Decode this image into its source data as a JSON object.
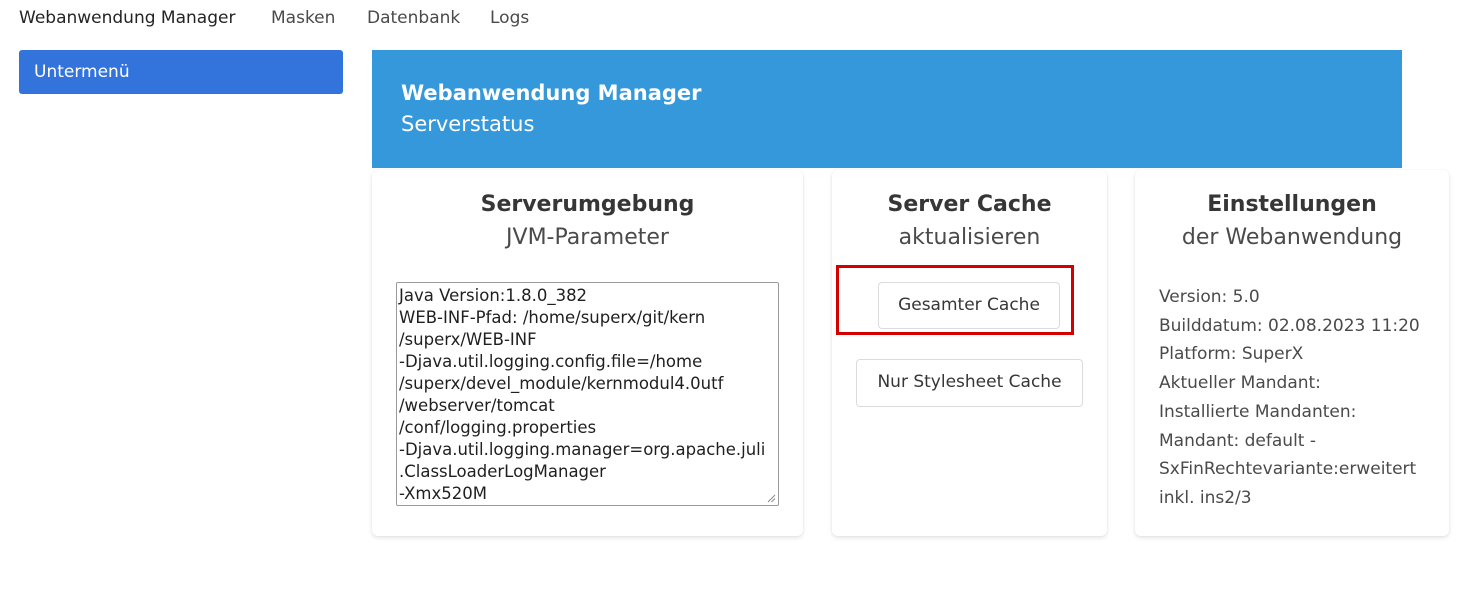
{
  "nav": {
    "brand": "Webanwendung Manager",
    "items": [
      "Masken",
      "Datenbank",
      "Logs"
    ]
  },
  "sidebar": {
    "submenu_label": "Untermenü"
  },
  "hero": {
    "title": "Webanwendung Manager",
    "subtitle": "Serverstatus",
    "color": "#3498db"
  },
  "cards": {
    "env": {
      "title": "Serverumgebung",
      "subtitle": "JVM-Parameter",
      "jvm_lines": [
        "Java Version:1.8.0_382",
        "WEB-INF-Pfad: /home/superx/git/kern",
        "/superx/WEB-INF",
        "-Djava.util.logging.config.file=/home",
        "/superx/devel_module/kernmodul4.0utf",
        "/webserver/tomcat",
        "/conf/logging.properties",
        "-Djava.util.logging.manager=org.apache.juli",
        ".ClassLoaderLogManager",
        "-Xmx520M"
      ]
    },
    "cache": {
      "title": "Server Cache",
      "subtitle": "aktualisieren",
      "btn_full": "Gesamter Cache",
      "btn_style": "Nur Stylesheet Cache",
      "highlight_color": "#d40000"
    },
    "settings": {
      "title": "Einstellungen",
      "subtitle": "der Webanwendung",
      "lines": [
        "Version: 5.0",
        "Builddatum: 02.08.2023 11:20",
        "Platform: SuperX",
        "Aktueller Mandant:",
        "Installierte Mandanten:",
        "Mandant: default -",
        "SxFinRechtevariante:erweitert",
        "inkl. ins2/3"
      ]
    }
  },
  "colors": {
    "primary": "#3273dc"
  }
}
